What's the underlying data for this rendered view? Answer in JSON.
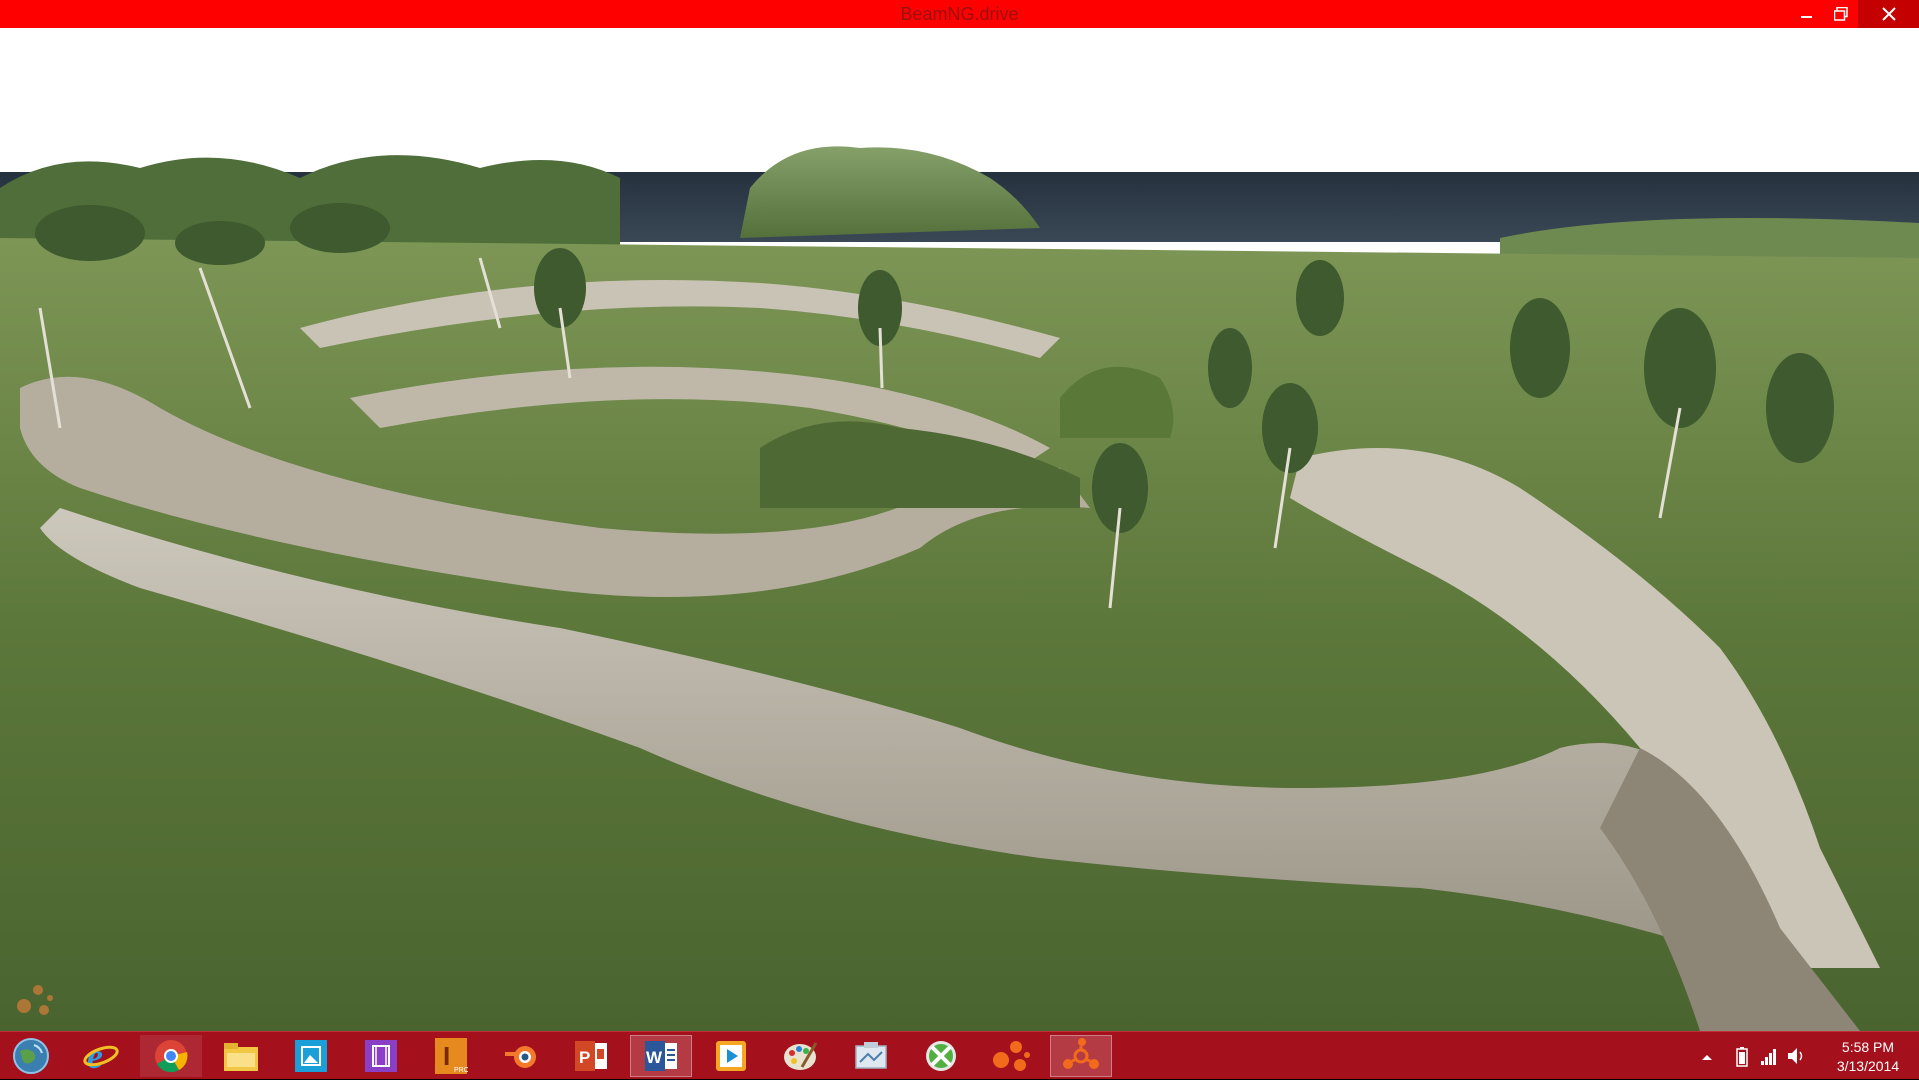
{
  "window": {
    "title": "BeamNG.drive",
    "controls": {
      "minimize_icon": "minimize-icon",
      "maximize_icon": "restore-icon",
      "close_icon": "close-icon"
    }
  },
  "colors": {
    "titlebar": "#ff0000",
    "taskbar": "#a4101b",
    "sky": "#ffffff",
    "sea": "#2a3a48",
    "grass": "#5d7a3a",
    "dirt": "#a8a295"
  },
  "taskbar": {
    "start_icon": "start-globe-icon",
    "apps": [
      {
        "name": "internet-explorer-icon"
      },
      {
        "name": "chrome-icon"
      },
      {
        "name": "file-explorer-icon"
      },
      {
        "name": "photo-app-icon"
      },
      {
        "name": "video-app-icon"
      },
      {
        "name": "inventor-pro-icon"
      },
      {
        "name": "blender-icon"
      },
      {
        "name": "powerpoint-icon"
      },
      {
        "name": "word-icon"
      },
      {
        "name": "media-player-icon"
      },
      {
        "name": "paint-icon"
      },
      {
        "name": "screenshot-tool-icon"
      },
      {
        "name": "xbox-app-icon"
      },
      {
        "name": "beamng-icon"
      },
      {
        "name": "beamng-drive-icon"
      }
    ],
    "tray": {
      "show_hidden_icon": "chevron-up-icon",
      "power_icon": "battery-icon",
      "network_icon": "signal-bars-icon",
      "volume_icon": "speaker-icon"
    },
    "clock": {
      "time": "5:58 PM",
      "date": "3/13/2014"
    }
  }
}
